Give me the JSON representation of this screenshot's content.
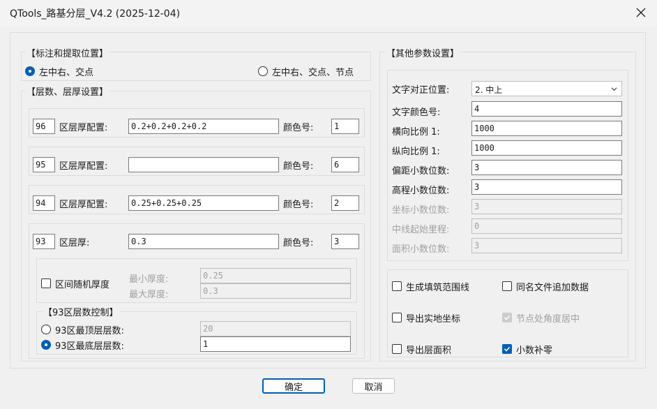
{
  "window": {
    "title": "QTools_路基分层_V4.2 (2025-12-04)"
  },
  "label_group": {
    "title": "【标注和提取位置】",
    "options": [
      {
        "label": "左中右、交点",
        "selected": true
      },
      {
        "label": "左中右、交点、节点",
        "selected": false
      }
    ]
  },
  "layer_group": {
    "title": "【层数、层厚设置】",
    "rows": [
      {
        "zone": "96",
        "label": "区层厚配置:",
        "thickness": "0.2+0.2+0.2+0.2",
        "color_label": "颜色号:",
        "color": "1"
      },
      {
        "zone": "95",
        "label": "区层厚配置:",
        "thickness": "",
        "color_label": "颜色号:",
        "color": "6"
      },
      {
        "zone": "94",
        "label": "区层厚配置:",
        "thickness": "0.25+0.25+0.25",
        "color_label": "颜色号:",
        "color": "2"
      },
      {
        "zone": "93",
        "label": "区层厚:",
        "thickness": "0.3",
        "color_label": "颜色号:",
        "color": "3"
      }
    ],
    "random": {
      "label": "区间随机厚度",
      "checked": false,
      "min_label": "最小厚度:",
      "min_value": "0.25",
      "max_label": "最大厚度:",
      "max_value": "0.3"
    },
    "control": {
      "title": "【93区层数控制】",
      "top_label": "93区最顶层层数:",
      "top_value": "20",
      "top_selected": false,
      "bottom_label": "93区最底层层数:",
      "bottom_value": "1",
      "bottom_selected": true
    }
  },
  "other_group": {
    "title": "【其他参数设置】",
    "align_label": "文字对正位置:",
    "align_value": "2. 中上",
    "params": [
      {
        "label": "文字颜色号:",
        "value": "4",
        "enabled": true
      },
      {
        "label": "横向比例 1:",
        "value": "1000",
        "enabled": true
      },
      {
        "label": "纵向比例 1:",
        "value": "1000",
        "enabled": true
      },
      {
        "label": "偏距小数位数:",
        "value": "3",
        "enabled": true
      },
      {
        "label": "高程小数位数:",
        "value": "3",
        "enabled": true
      },
      {
        "label": "坐标小数位数:",
        "value": "3",
        "enabled": false
      },
      {
        "label": "中线起始里程:",
        "value": "0",
        "enabled": false
      },
      {
        "label": "面积小数位数:",
        "value": "3",
        "enabled": false
      }
    ],
    "checks": [
      {
        "label": "生成填筑范围线",
        "checked": false,
        "enabled": true
      },
      {
        "label": "同名文件追加数据",
        "checked": false,
        "enabled": true
      },
      {
        "label": "导出实地坐标",
        "checked": false,
        "enabled": true
      },
      {
        "label": "节点处角度居中",
        "checked": true,
        "enabled": false
      },
      {
        "label": "导出层面积",
        "checked": false,
        "enabled": true
      },
      {
        "label": "小数补零",
        "checked": true,
        "enabled": true
      }
    ]
  },
  "buttons": {
    "ok": "确定",
    "cancel": "取消"
  },
  "colors": {
    "accent": "#005fb8",
    "disabled_text": "#a0a0a0"
  }
}
